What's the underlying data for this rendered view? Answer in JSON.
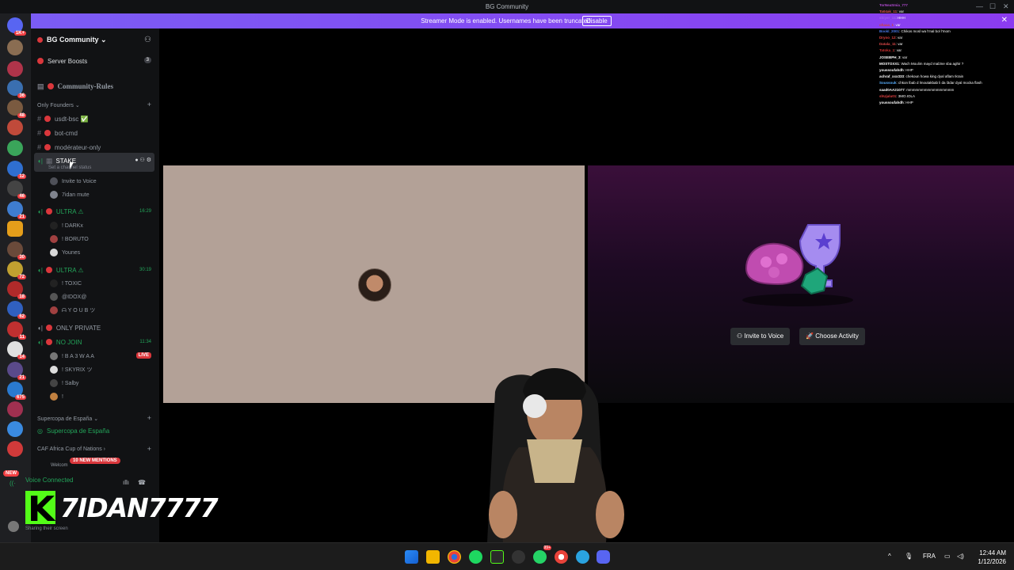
{
  "window": {
    "title": "BG Community"
  },
  "banner": {
    "message": "Streamer Mode is enabled. Usernames have been truncated.",
    "disable_label": "Disable"
  },
  "sidebar": {
    "server_name": "BG Community ⌄",
    "boosts_label": "Server Boosts",
    "boosts_count": "3",
    "rules_channel": "Community-Rules",
    "category_founders": "Only Founders ⌄",
    "text_channels": [
      "usdt-bsc ✅",
      "bot-cmd",
      "modérateur-only"
    ],
    "stake": {
      "name": "STAKE",
      "status": "Set a channel status",
      "invite_label": "Invite to Voice",
      "member": "7idan mute"
    },
    "ultra1": {
      "name": "ULTRA ⚠",
      "time": "16:29",
      "members": [
        "! DARKx",
        "! BORUTO",
        "Younes"
      ]
    },
    "ultra2": {
      "name": "ULTRA ⚠",
      "time": "30:19",
      "members": [
        "! TOXIC",
        "@IDOX@",
        "ᗩ Y O U B ツ"
      ]
    },
    "only_private": "ONLY PRIVATE",
    "no_join": {
      "name": "NO JOIN",
      "time": "11:34",
      "live": "LIVE",
      "members": [
        "! B A 3 W A A",
        "! SKYRIX ツ",
        "! Salby",
        "!"
      ]
    },
    "category_supercopa": "Supercopa de España ⌄",
    "supercopa": "Supercopa de España",
    "category_caf": "CAF Africa Cup of Nations ›",
    "welcome": "Welcom",
    "mentions_badge": "10 NEW MENTIONS",
    "voice_connected": "Voice Connected",
    "sharing": "Sharing their screen"
  },
  "servers": {
    "badges": [
      "1K+",
      "36",
      "48",
      "12",
      "46",
      "21",
      "30",
      "72",
      "18",
      "62",
      "11",
      "14",
      "21",
      "675"
    ],
    "new_badge": "NEW"
  },
  "stage": {
    "invite_label": "Invite to Voice",
    "activity_label": "Choose Activity"
  },
  "overlay": {
    "streamer": "7IDAN7777",
    "chat": [
      {
        "u": "TorNeaSmia_777",
        "m": ""
      },
      {
        "u": "Ta04ak_11",
        "m": ": var"
      },
      {
        "u": "shiyer_11",
        "m": ": HHH"
      },
      {
        "u": "ohaaa_1",
        "m": ": var"
      },
      {
        "u": "Bookl_2001",
        "m": ": Chikos mosl wa l'mal bol l'mom"
      },
      {
        "u": "Dryno_12",
        "m": ": var"
      },
      {
        "u": "Datala_11",
        "m": ": var"
      },
      {
        "u": "Tatoka_1",
        "m": ": var"
      },
      {
        "u": "JOSEBPH_3",
        "m": ": var"
      },
      {
        "u": "MOSTOXX1",
        "m": ": Wach Moulim mayd mal3ne sba aghir ?"
      },
      {
        "u": "youssoufahdh",
        "m": ": HHP"
      },
      {
        "u": "achraf_xxx333",
        "m": ": chekoun howa king dyal aflam Ikrain"
      },
      {
        "u": "Soussouk",
        "m": ": chkon lbab d lmoutakbab li da l3dar dyal mocka flash"
      },
      {
        "u": "saad0AA21077",
        "m": ": mmmmmmmmmmmmmmmm"
      },
      {
        "u": "shUjalu01",
        "m": ": 3MO.IOLA"
      },
      {
        "u": "youssoufahdh",
        "m": ": HHP"
      }
    ]
  },
  "taskbar": {
    "lang": "FRA",
    "time": "12:44 AM",
    "date": "1/12/2026",
    "badge": "99+"
  }
}
